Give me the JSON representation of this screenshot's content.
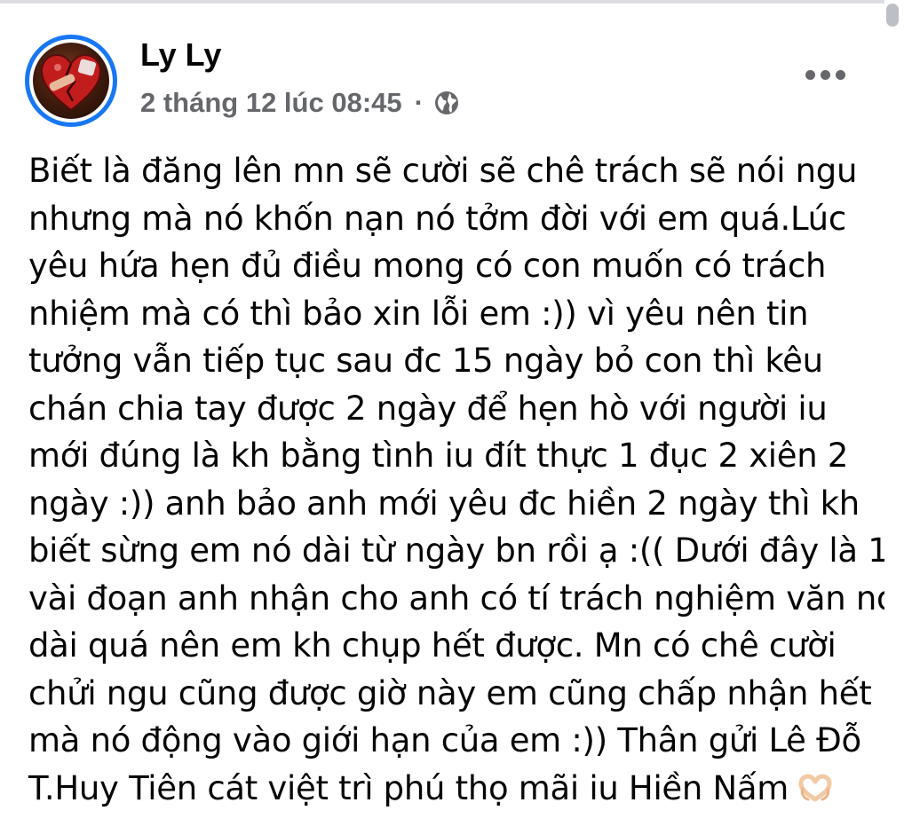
{
  "post": {
    "author": "Ly Ly",
    "timestamp": "2 tháng 12 lúc 08:45",
    "separator": "·",
    "privacy_icon": "globe-icon",
    "more_icon": "more-options-icon",
    "body_lines": [
      "Biết là đăng lên mn sẽ cười sẽ chê trách sẽ nói ngu",
      "nhưng mà nó khốn nạn nó tởm đời với em quá.Lúc",
      "yêu hứa hẹn đủ điều mong có con muốn có trách",
      "nhiệm mà có thì bảo xin lỗi em :)) vì yêu nên tin",
      "tưởng vẫn tiếp tục sau đc 15 ngày bỏ con thì kêu",
      "chán chia tay được 2 ngày để hẹn hò với người iu",
      "mới đúng là kh bằng tình iu đít thực 1 đục 2 xiên 2",
      "ngày :)) anh bảo anh mới yêu đc hiền 2 ngày thì kh",
      "biết sừng em nó dài từ ngày bn rồi ạ :(( Dưới đây là 1",
      "vài đoạn anh nhận cho anh có tí trách nghiệm văn nó",
      "dài quá nên em kh chụp hết được. Mn có chê cười",
      "chửi ngu cũng được giờ này em cũng chấp nhận hết",
      "mà nó động vào giới hạn của em :)) Thân gửi Lê Đỗ",
      "T.Huy Tiên cát việt trì phú thọ mãi iu Hiền Nấm"
    ],
    "trailing_emoji": "heart-hands-emoji"
  },
  "colors": {
    "accent": "#1877f2",
    "text": "#050505",
    "secondary_text": "#65676b"
  }
}
